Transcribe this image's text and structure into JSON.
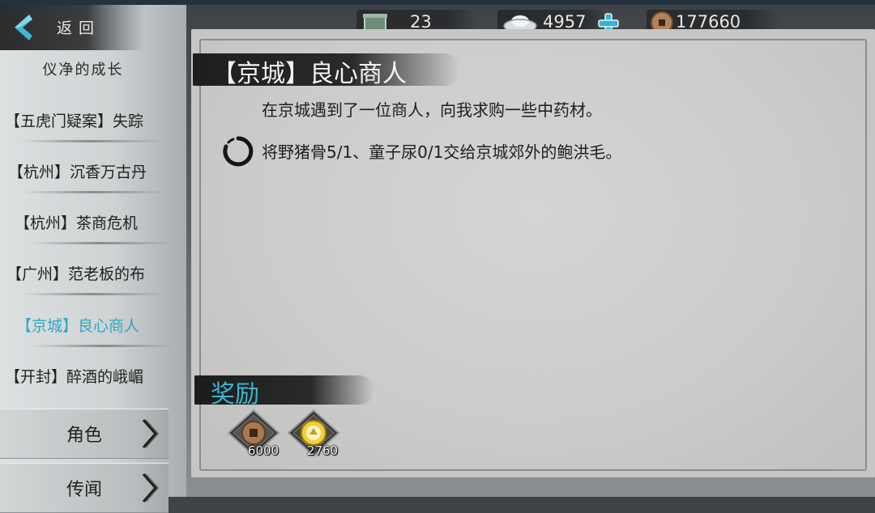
{
  "nav": {
    "back_label": "返回"
  },
  "resources": [
    {
      "name": "bag-capacity",
      "icon": "chest-icon",
      "value": "23"
    },
    {
      "name": "silver",
      "icon": "silver-ingot-icon",
      "value": "4957"
    },
    {
      "name": "copper",
      "icon": "copper-coin-icon",
      "value": "177660"
    }
  ],
  "sidebar": {
    "section_title": "仪净的成长",
    "quests": [
      {
        "label": "【五虎门疑案】失踪"
      },
      {
        "label": "【杭州】沉香万古丹"
      },
      {
        "label": "【杭州】茶商危机"
      },
      {
        "label": "【广州】范老板的布"
      },
      {
        "label": "【京城】良心商人",
        "active": true
      },
      {
        "label": "【开封】醉酒的峨嵋"
      }
    ],
    "categories": [
      {
        "label": "角色"
      },
      {
        "label": "传闻"
      }
    ]
  },
  "quest": {
    "title": "【京城】良心商人",
    "description": "在京城遇到了一位商人，向我求购一些中药材。",
    "objective": "将野猪骨5/1、童子尿0/1交给京城郊外的鲍洪毛。"
  },
  "rewards": {
    "title": "奖励",
    "items": [
      {
        "icon": "copper-coin-icon",
        "value": "6000"
      },
      {
        "icon": "experience-icon",
        "value": "2760"
      }
    ]
  },
  "colors": {
    "active_quest": "#2fa9c2",
    "reward_title": "#38b7cf",
    "plus": "#33b5d6"
  }
}
